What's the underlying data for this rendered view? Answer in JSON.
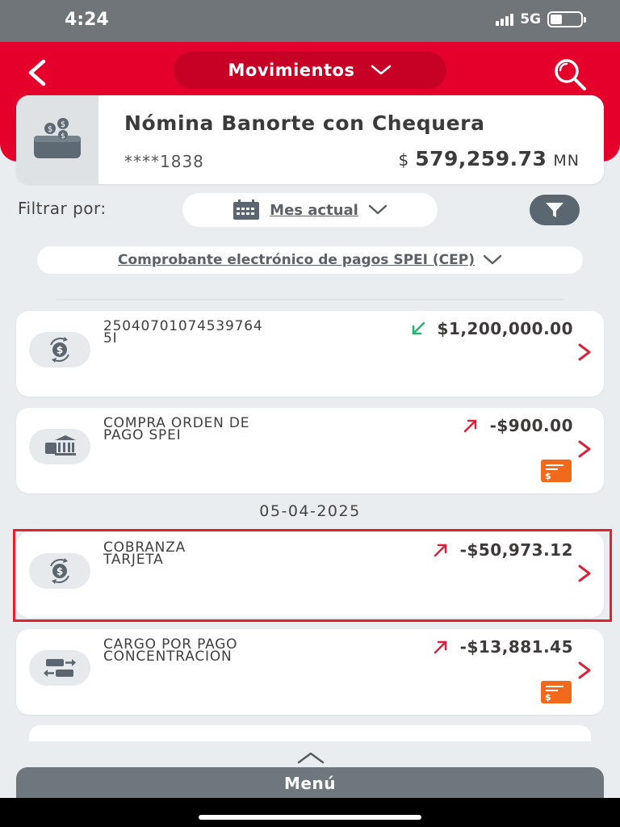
{
  "status": {
    "time": "4:24",
    "network": "5G"
  },
  "header": {
    "title": "Movimientos"
  },
  "account": {
    "name": "Nómina Banorte con Chequera",
    "number": "****1838",
    "currency_symbol": "$",
    "balance": "579,259.73",
    "currency_code": "MN"
  },
  "filters": {
    "label": "Filtrar por:",
    "period": "Mes actual",
    "cep": "Comprobante electrónico de pagos SPEI (CEP)"
  },
  "transactions": [
    {
      "line1": "25040701074539764",
      "line2": "5I",
      "amount": "$1,200,000.00",
      "direction": "in",
      "icon": "money-exchange-icon",
      "has_receipt": false
    },
    {
      "line1": "COMPRA ORDEN DE",
      "line2": "PAGO SPEI",
      "amount": "-$900.00",
      "direction": "out",
      "icon": "bank-icon",
      "has_receipt": true
    },
    {
      "line1": "COBRANZA",
      "line2": "TARJETA",
      "amount": "-$50,973.12",
      "direction": "out",
      "icon": "money-exchange-icon",
      "has_receipt": false
    },
    {
      "line1": "CARGO POR PAGO",
      "line2": "CONCENTRACION",
      "amount": "-$13,881.45",
      "direction": "out",
      "icon": "transfer-icon",
      "has_receipt": true
    }
  ],
  "date_separator": "05-04-2025",
  "menu": {
    "label": "Menú"
  },
  "colors": {
    "brand_red": "#e4002b",
    "in_green": "#1fb56b",
    "out_red": "#d9233a",
    "receipt_orange": "#f16a1c"
  }
}
